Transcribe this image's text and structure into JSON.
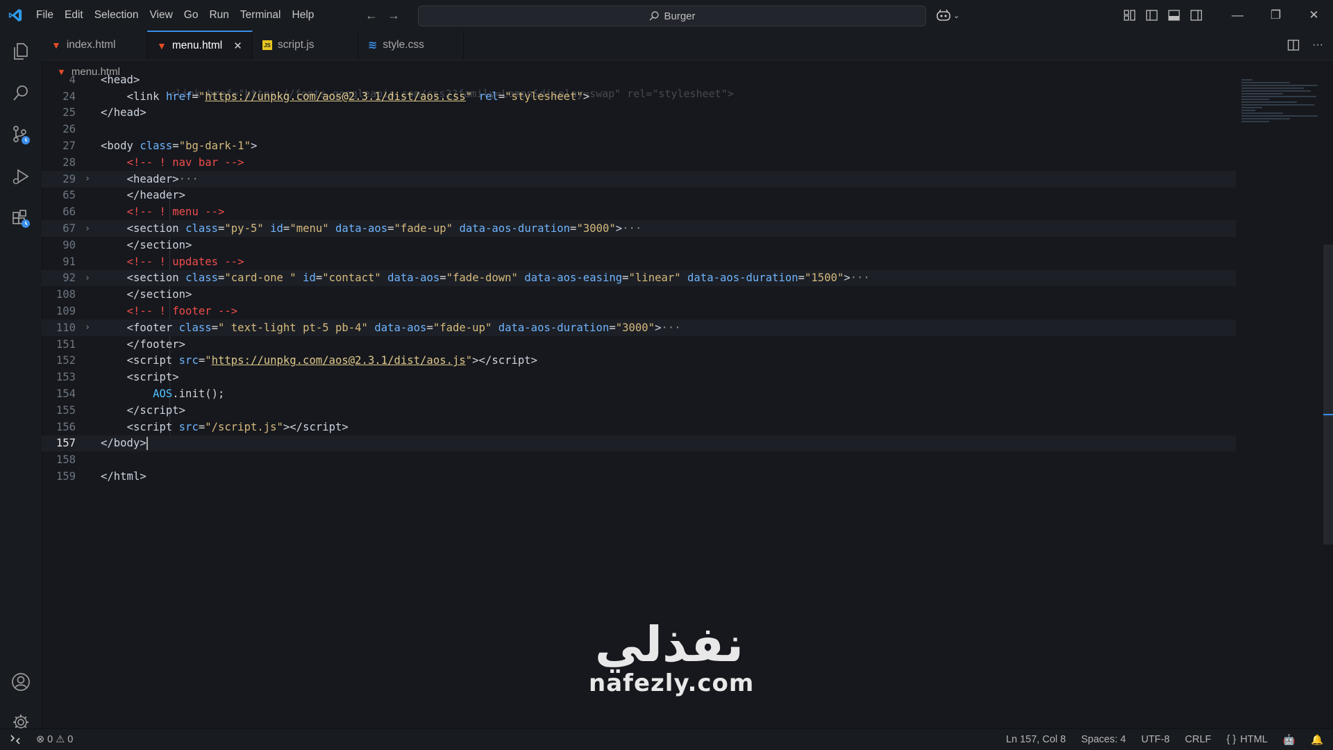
{
  "menubar": {
    "items": [
      "File",
      "Edit",
      "Selection",
      "View",
      "Go",
      "Run",
      "Terminal",
      "Help"
    ]
  },
  "search": {
    "text": "Burger"
  },
  "tabs": [
    {
      "label": "index.html",
      "icon": "html-file-icon",
      "active": false
    },
    {
      "label": "menu.html",
      "icon": "html-file-icon",
      "active": true
    },
    {
      "label": "script.js",
      "icon": "js-file-icon",
      "active": false
    },
    {
      "label": "style.css",
      "icon": "css-file-icon",
      "active": false
    }
  ],
  "breadcrumb": {
    "file": "menu.html"
  },
  "sticky": {
    "ghost": "<link href=\"https://fonts.googleapis.com/css2?family=Lemon&display=swap\" rel=\"stylesheet\">"
  },
  "editor": {
    "lines": [
      {
        "n": "4",
        "html": "<span class='tag'>&lt;head&gt;</span>"
      },
      {
        "n": "24",
        "html": "    <span class='tag'>&lt;link</span> <span class='attr'>href</span>=<span class='str'>\"</span><span class='url'>https://unpkg.com/aos@2.3.1/dist/aos.css</span><span class='str'>\"</span> <span class='attr'>rel</span>=<span class='str'>\"stylesheet\"</span><span class='tag'>&gt;</span>"
      },
      {
        "n": "25",
        "html": "<span class='tag'>&lt;/head&gt;</span>"
      },
      {
        "n": "26",
        "html": ""
      },
      {
        "n": "27",
        "html": "<span class='tag'>&lt;body</span> <span class='attr'>class</span>=<span class='str'>\"bg-dark-1\"</span><span class='tag'>&gt;</span>"
      },
      {
        "n": "28",
        "html": "    <span class='cmt'>&lt;!-- ! nav bar --&gt;</span>"
      },
      {
        "n": "29",
        "html": "    <span class='tag'>&lt;header&gt;</span><span class='dots'>···</span>",
        "fold": true,
        "hl": true
      },
      {
        "n": "65",
        "html": "    <span class='tag'>&lt;/header&gt;</span>"
      },
      {
        "n": "66",
        "html": "    <span class='cmt'>&lt;!-- ! menu --&gt;</span>"
      },
      {
        "n": "67",
        "html": "    <span class='tag'>&lt;section</span> <span class='attr'>class</span>=<span class='str'>\"py-5\"</span> <span class='attr'>id</span>=<span class='str'>\"menu\"</span> <span class='attr'>data-aos</span>=<span class='str'>\"fade-up\"</span> <span class='attr'>data-aos-duration</span>=<span class='str'>\"3000\"</span><span class='tag'>&gt;</span><span class='dots'>···</span>",
        "fold": true,
        "hl": true
      },
      {
        "n": "90",
        "html": "    <span class='tag'>&lt;/section&gt;</span>"
      },
      {
        "n": "91",
        "html": "    <span class='cmt'>&lt;!-- ! updates --&gt;</span>"
      },
      {
        "n": "92",
        "html": "    <span class='tag'>&lt;section</span> <span class='attr'>class</span>=<span class='str'>\"card-one \"</span> <span class='attr'>id</span>=<span class='str'>\"contact\"</span> <span class='attr'>data-aos</span>=<span class='str'>\"fade-down\"</span> <span class='attr'>data-aos-easing</span>=<span class='str'>\"linear\"</span> <span class='attr'>data-aos-duration</span>=<span class='str'>\"1500\"</span><span class='tag'>&gt;</span><span class='dots'>···</span>",
        "fold": true,
        "hl": true
      },
      {
        "n": "108",
        "html": "    <span class='tag'>&lt;/section&gt;</span>"
      },
      {
        "n": "109",
        "html": "    <span class='cmt'>&lt;!-- ! footer --&gt;</span>"
      },
      {
        "n": "110",
        "html": "    <span class='tag'>&lt;footer</span> <span class='attr'>class</span>=<span class='str'>\" text-light pt-5 pb-4\"</span> <span class='attr'>data-aos</span>=<span class='str'>\"fade-up\"</span> <span class='attr'>data-aos-duration</span>=<span class='str'>\"3000\"</span><span class='tag'>&gt;</span><span class='dots'>···</span>",
        "fold": true,
        "hl": true
      },
      {
        "n": "151",
        "html": "    <span class='tag'>&lt;/footer&gt;</span>"
      },
      {
        "n": "152",
        "html": "    <span class='tag'>&lt;script</span> <span class='attr'>src</span>=<span class='str'>\"</span><span class='url'>https://unpkg.com/aos@2.3.1/dist/aos.js</span><span class='str'>\"</span><span class='tag'>&gt;&lt;/script&gt;</span>"
      },
      {
        "n": "153",
        "html": "    <span class='tag'>&lt;script&gt;</span>"
      },
      {
        "n": "154",
        "html": "        <span class='kw'>AOS</span>.init();"
      },
      {
        "n": "155",
        "html": "    <span class='tag'>&lt;/script&gt;</span>"
      },
      {
        "n": "156",
        "html": "    <span class='tag'>&lt;script</span> <span class='attr'>src</span>=<span class='str'>\"/script.js\"</span><span class='tag'>&gt;&lt;/script&gt;</span>"
      },
      {
        "n": "157",
        "html": "<span class='tag'>&lt;/body&gt;</span><span class='cursor'></span>",
        "current": true,
        "hl": true
      },
      {
        "n": "158",
        "html": ""
      },
      {
        "n": "159",
        "html": "<span class='tag'>&lt;/html&gt;</span>"
      }
    ]
  },
  "watermark": {
    "arabic": "نفذلي",
    "latin": "nafezly.com"
  },
  "statusbar": {
    "errors": "0",
    "warnings": "0",
    "position": "Ln 157, Col 8",
    "spaces": "Spaces: 4",
    "encoding": "UTF-8",
    "eol": "CRLF",
    "language": "HTML"
  },
  "colors": {
    "accent": "#3b8eea",
    "vscode_blue": "#2f9ae8",
    "comment": "#f14c4c",
    "attr": "#6fb4ff",
    "string": "#d7ba7d"
  }
}
